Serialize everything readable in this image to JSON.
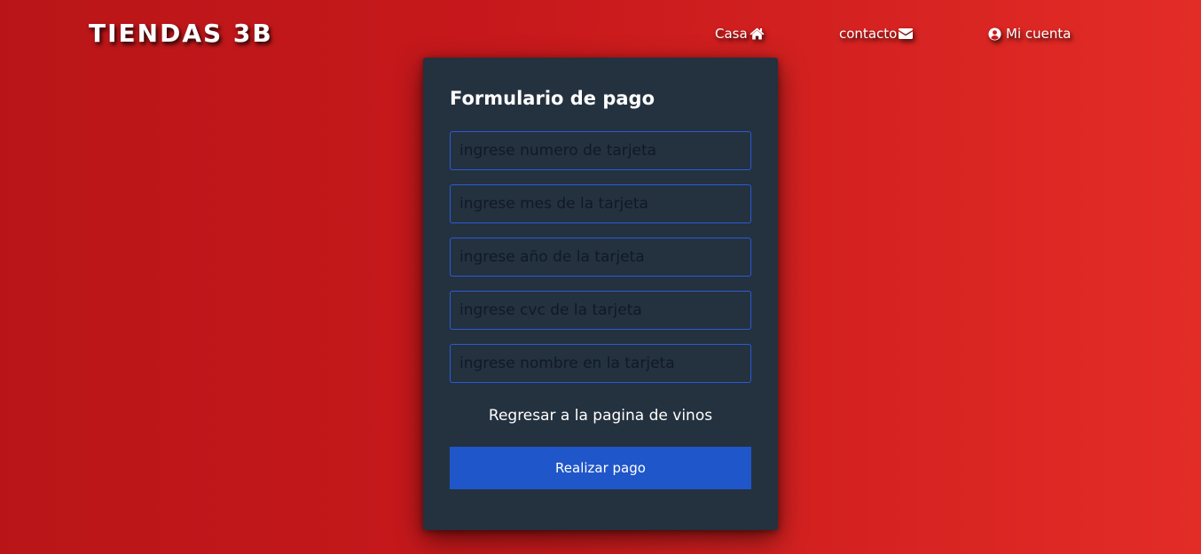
{
  "header": {
    "brand": "TIENDAS 3B",
    "nav": [
      {
        "label": "Casa",
        "icon": "home-icon"
      },
      {
        "label": "contacto",
        "icon": "envelope-icon"
      },
      {
        "label": "Mi cuenta",
        "icon": "user-circle-icon"
      }
    ]
  },
  "form": {
    "title": "Formulario de pago",
    "fields": [
      {
        "placeholder": "ingrese numero de tarjeta",
        "value": ""
      },
      {
        "placeholder": "ingrese mes de la tarjeta",
        "value": ""
      },
      {
        "placeholder": "ingrese año de la tarjeta",
        "value": ""
      },
      {
        "placeholder": "ingrese cvc de la tarjeta",
        "value": ""
      },
      {
        "placeholder": "ingrese nombre en la tarjeta",
        "value": ""
      }
    ],
    "back_link": "Regresar a la pagina de vinos",
    "submit_label": "Realizar pago"
  },
  "colors": {
    "background_start": "#b91518",
    "background_end": "#e32c26",
    "card": "#24313f",
    "field_border": "#2a5bd7",
    "button": "#1f56c9",
    "text": "#ffffff"
  }
}
